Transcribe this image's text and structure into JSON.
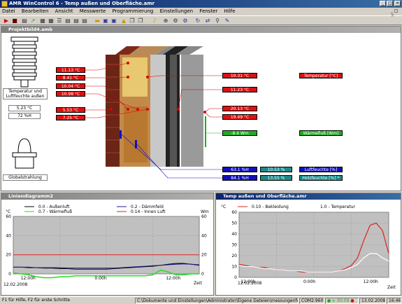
{
  "app": {
    "title": "AMR WinControl 6 - Temp außen und Oberfläche.amr",
    "min": "_",
    "max": "□",
    "close": "×"
  },
  "menu": [
    "Datei",
    "Bearbeiten",
    "Ansicht",
    "Messwerte",
    "Programmierung",
    "Einstellungen",
    "Fenster",
    "Hilfe"
  ],
  "toolbar_icons": [
    "run-icon",
    "stop-icon",
    "save-icon",
    "chart-icon",
    "table-icon",
    "grid-icon",
    "list-icon",
    "open-icon",
    "folder-icon",
    "print-icon",
    "lock-icon",
    "copy-icon",
    "paste-icon",
    "bell-icon",
    "probe-icon",
    "gear-icon",
    "settings-icon",
    "tools-icon",
    "connect-icon",
    "link-icon",
    "wand-icon"
  ],
  "projekt": {
    "title": "Projektbild4.amb",
    "sensor1_label": "Temperatur und Luftfeuchte außen",
    "sensor1_temp": "5.23 °C",
    "sensor1_hum": "72 %H",
    "sensor2_label": "Globalstrahlung",
    "left_values": [
      "11.13 °C",
      "8.41 °C",
      "10.04 °C",
      "10.98 °C",
      "5.53 °C",
      "7.25 °C"
    ],
    "right_values": [
      "10.31 °C",
      "11.23 °C",
      "20.13 °C",
      "19.49 °C"
    ],
    "flux_value": "-8.4 Wm",
    "hum_values": [
      "63.1 %H",
      "84.1 %H"
    ],
    "wood_values": [
      "10.53 %",
      "13.55 %"
    ],
    "legend": {
      "temp": "Temperatur [°C]",
      "flux": "Wärmefluß [Wm]",
      "hum": "Luftfeuchte [%]",
      "wood": "Holzfeuchte [%] *"
    }
  },
  "linien": {
    "title": "Liniendiagramm2",
    "legend": [
      "0.0 - Außenluft",
      "0.2 - Dämmfeld",
      "0.7 - Wärmefluß",
      "0.14 - Innen Luft"
    ],
    "legend_colors": [
      "#000000",
      "#1a1a8a",
      "#22dd22",
      "#dd2222"
    ],
    "y_unit_left": "°C",
    "y_unit_right": "Wm",
    "x_ticks": [
      "12:00h",
      "0:00h",
      "12:00h"
    ],
    "date": "12.02.2008",
    "x_unit": "Zeit",
    "chart_data": {
      "type": "line",
      "y_left_ticks": [
        "60",
        "40",
        "20",
        "0"
      ],
      "y_right_ticks": [
        "60",
        "40",
        "20",
        "0"
      ],
      "ylim": [
        0,
        60
      ],
      "x": [
        0,
        1,
        2,
        3,
        4,
        5,
        6,
        7,
        8,
        9,
        10,
        11,
        12,
        13,
        14,
        15,
        16,
        17,
        18,
        19,
        20,
        21,
        22,
        23,
        24
      ],
      "series": [
        {
          "name": "0.0 - Außenluft",
          "values": [
            7,
            7,
            6.5,
            6.5,
            6,
            6,
            5.5,
            5.5,
            5,
            5,
            5,
            5,
            5,
            5.5,
            6,
            6.5,
            7,
            7.5,
            8,
            9,
            10,
            11,
            11,
            10,
            9
          ]
        },
        {
          "name": "0.2 - Dämmfeld",
          "values": [
            7,
            7,
            7,
            6.5,
            6.5,
            6.5,
            6.5,
            6,
            6,
            6,
            6,
            6,
            6,
            6,
            6.5,
            7,
            7.5,
            8,
            8.5,
            9,
            9.5,
            10,
            10.5,
            10,
            9.5
          ]
        },
        {
          "name": "0.7 - Wärmefluß",
          "values": [
            1,
            0,
            -1,
            -3,
            -4,
            -4,
            -3,
            -3,
            -2,
            -2,
            -2,
            -2,
            -2,
            -2,
            -2,
            -2,
            -2,
            -2,
            -1,
            4,
            2,
            -1,
            -1,
            0,
            0
          ]
        },
        {
          "name": "0.14 - Innen Luft",
          "values": [
            20,
            20,
            20,
            20,
            20,
            20,
            20,
            20,
            20,
            20,
            20,
            20,
            20,
            20,
            20,
            20,
            20,
            20,
            20,
            20,
            20,
            20,
            20,
            20,
            20
          ]
        }
      ]
    }
  },
  "temp": {
    "title": "Temp außen und Oberfläche.amr",
    "legend": [
      "0.10 - Bekleidung",
      "1.0 - Temperatur"
    ],
    "legend_colors": [
      "#dd2222",
      "#ffffff"
    ],
    "y_unit": "°C",
    "x_ticks": [
      "12:00h",
      "0:00h",
      "12:00h"
    ],
    "date": "12.02.2008",
    "x_unit": "Zeit",
    "chart_data": {
      "type": "line",
      "y_ticks": [
        "60",
        "50",
        "40",
        "30",
        "20",
        "10",
        "0"
      ],
      "ylim": [
        0,
        60
      ],
      "x": [
        0,
        1,
        2,
        3,
        4,
        5,
        6,
        7,
        8,
        9,
        10,
        11,
        12,
        13,
        14,
        15,
        16,
        17,
        18,
        19,
        20,
        21,
        22,
        23,
        24
      ],
      "series": [
        {
          "name": "0.10 - Bekleidung",
          "values": [
            12,
            11,
            10,
            9,
            9,
            8,
            7,
            7,
            6,
            6,
            5,
            5,
            5,
            5,
            5,
            5,
            6,
            8,
            11,
            18,
            34,
            48,
            50,
            43,
            22
          ]
        },
        {
          "name": "1.0 - Temperatur",
          "values": [
            11,
            10,
            10,
            9,
            8,
            8,
            7,
            7,
            6,
            6,
            6,
            5,
            5,
            5,
            5,
            5,
            6,
            7,
            9,
            12,
            18,
            22,
            22,
            18,
            15
          ]
        }
      ]
    }
  },
  "status": {
    "help": "F1 für Hilfe, F2 für erste Schritte",
    "path": "C:\\Dokumente und Einstellungen\\Administrator\\Eigene Dateien\\messungenfeb4.amr",
    "port": "COM2:9600",
    "timer": "00:09",
    "date": "13.02.2008",
    "time": "16:46"
  }
}
